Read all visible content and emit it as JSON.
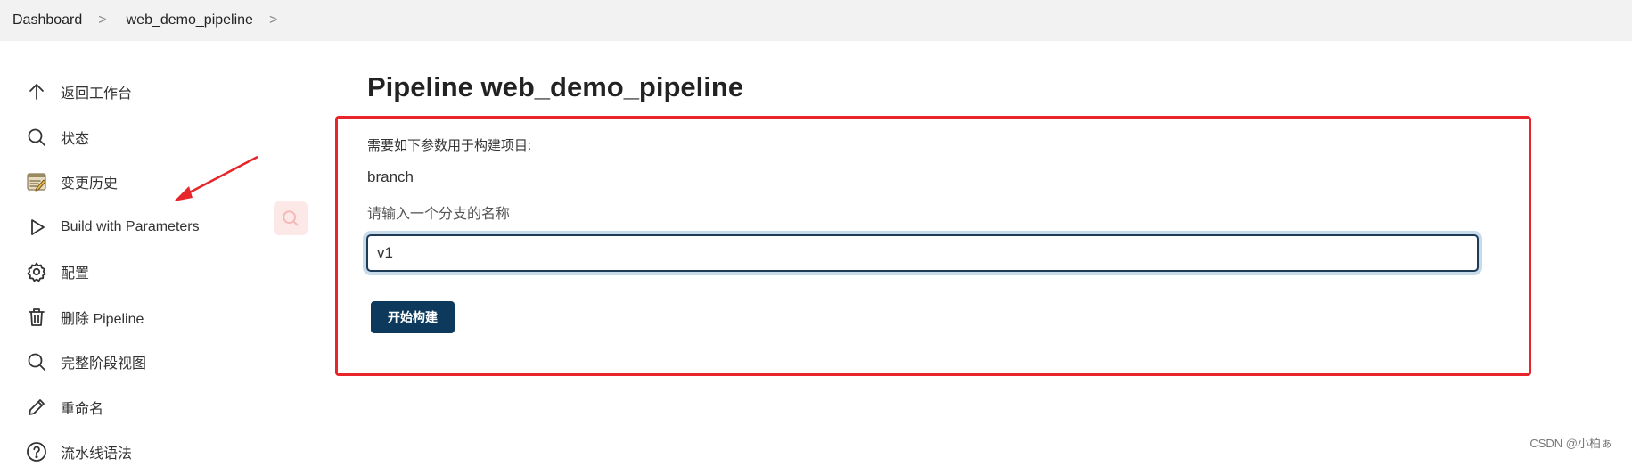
{
  "breadcrumb": {
    "items": [
      "Dashboard",
      "web_demo_pipeline"
    ],
    "separator": ">"
  },
  "sidebar": {
    "items": [
      {
        "label": "返回工作台",
        "icon": "arrow-up-icon"
      },
      {
        "label": "状态",
        "icon": "search-icon"
      },
      {
        "label": "变更历史",
        "icon": "notepad-icon"
      },
      {
        "label": "Build with Parameters",
        "icon": "play-icon"
      },
      {
        "label": "配置",
        "icon": "gear-icon"
      },
      {
        "label": "删除 Pipeline",
        "icon": "trash-icon"
      },
      {
        "label": "完整阶段视图",
        "icon": "search-icon"
      },
      {
        "label": "重命名",
        "icon": "pencil-icon"
      },
      {
        "label": "流水线语法",
        "icon": "help-icon"
      }
    ]
  },
  "main": {
    "title": "Pipeline web_demo_pipeline",
    "description": "需要如下参数用于构建项目:",
    "parameter": {
      "name": "branch",
      "description": "请输入一个分支的名称",
      "value": "v1"
    },
    "build_button_label": "开始构建"
  },
  "watermark": "CSDN @小柏ぁ",
  "colors": {
    "accent": "#0d3a5c",
    "highlight": "#e8252a",
    "topbar": "#f2f2f3"
  }
}
